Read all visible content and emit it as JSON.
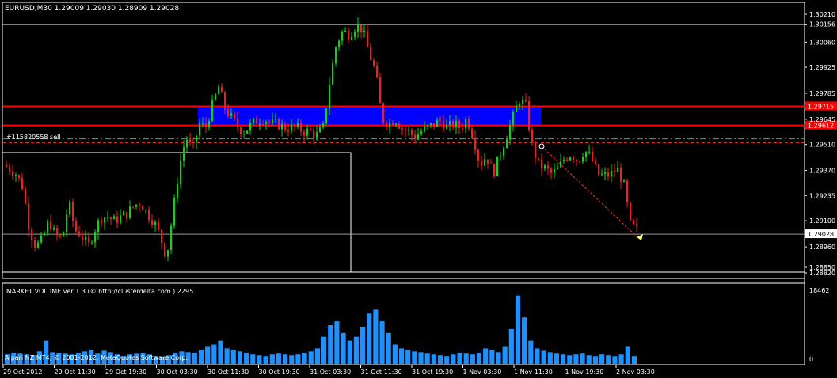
{
  "header": {
    "symbol_line": "EURUSD,M30  1.29009 1.29030 1.28909 1.29028"
  },
  "trade_label": "#115820558 sell",
  "indicator": {
    "title": "MARKET VOLUME ver 1.3 (© http://clusterdelta.com ) 2295",
    "scale_top": "18462",
    "scale_bottom": "0"
  },
  "copyright": "Alpari NZ MT4, © 2001-2012, MetaQuotes Software Corp.",
  "colors": {
    "background": "#000000",
    "bull": "#00e000",
    "bear": "#ff1a1a",
    "zone": "#0000ff",
    "volume": "#1e90ff",
    "level_line": "#ff0000"
  },
  "chart_data": {
    "type": "candlestick",
    "price_axis": {
      "ticks": [
        "1.30210",
        "1.30156",
        "1.30060",
        "1.29925",
        "1.29785",
        "1.29645",
        "1.29510",
        "1.29370",
        "1.29235",
        "1.29100",
        "1.28960",
        "1.28850",
        "1.28820"
      ],
      "ylim": [
        1.2882,
        1.3021
      ],
      "current_price": "1.29028"
    },
    "time_axis": {
      "ticks": [
        "29 Oct 2012",
        "29 Oct 11:30",
        "29 Oct 19:30",
        "30 Oct 03:30",
        "30 Oct 11:30",
        "30 Oct 19:30",
        "31 Oct 03:30",
        "31 Oct 11:30",
        "31 Oct 19:30",
        "1 Nov 03:30",
        "1 Nov 11:30",
        "1 Nov 19:30",
        "2 Nov 03:30"
      ]
    },
    "zone": {
      "price_top": 1.29715,
      "price_bottom": 1.29612,
      "top_tag": "1.29715",
      "bottom_tag": "1.29612"
    },
    "levels": [
      {
        "price": 1.29715,
        "style": "solid"
      },
      {
        "price": 1.29612,
        "style": "solid"
      },
      {
        "price": 1.2954,
        "style": "dashdot"
      },
      {
        "price": 1.2952,
        "style": "dashed"
      },
      {
        "price": 1.29028,
        "style": "grey"
      }
    ],
    "close_path": [
      1.294,
      1.2938,
      1.2935,
      1.2928,
      1.2905,
      1.2896,
      1.29,
      1.291,
      1.2902,
      1.29,
      1.292,
      1.2905,
      1.2902,
      1.2896,
      1.2905,
      1.2912,
      1.2912,
      1.291,
      1.2912,
      1.2914,
      1.2918,
      1.292,
      1.2914,
      1.291,
      1.2902,
      1.289,
      1.2915,
      1.294,
      1.2955,
      1.2948,
      1.2962,
      1.296,
      1.2972,
      1.2982,
      1.297,
      1.2965,
      1.296,
      1.2958,
      1.2962,
      1.2964,
      1.2965,
      1.2962,
      1.2962,
      1.296,
      1.296,
      1.296,
      1.2958,
      1.2958,
      1.2956,
      1.296,
      1.2985,
      1.3005,
      1.3012,
      1.301,
      1.3015,
      1.3013,
      1.3,
      1.299,
      1.2965,
      1.2962,
      1.2965,
      1.296,
      1.2958,
      1.2955,
      1.2958,
      1.296,
      1.2962,
      1.2964,
      1.296,
      1.2962,
      1.296,
      1.2965,
      1.2955,
      1.294,
      1.2945,
      1.2935,
      1.2945,
      1.2955,
      1.2965,
      1.2975,
      1.2972,
      1.295,
      1.294,
      1.2938,
      1.2935,
      1.2938,
      1.2944,
      1.2946,
      1.2942,
      1.2948,
      1.2944,
      1.2935,
      1.2934,
      1.2935,
      1.2938,
      1.293,
      1.2908,
      1.2905
    ],
    "volume": [
      0.12,
      0.14,
      0.13,
      0.12,
      0.11,
      0.16,
      0.3,
      0.15,
      0.14,
      0.13,
      0.12,
      0.14,
      0.16,
      0.18,
      0.13,
      0.17,
      0.15,
      0.12,
      0.1,
      0.12,
      0.13,
      0.14,
      0.12,
      0.1,
      0.09,
      0.11,
      0.14,
      0.16,
      0.15,
      0.14,
      0.18,
      0.22,
      0.25,
      0.3,
      0.2,
      0.18,
      0.16,
      0.14,
      0.12,
      0.11,
      0.1,
      0.12,
      0.13,
      0.12,
      0.11,
      0.12,
      0.14,
      0.16,
      0.2,
      0.35,
      0.5,
      0.55,
      0.4,
      0.3,
      0.35,
      0.48,
      0.65,
      0.7,
      0.55,
      0.4,
      0.25,
      0.2,
      0.18,
      0.16,
      0.15,
      0.13,
      0.12,
      0.11,
      0.1,
      0.12,
      0.14,
      0.13,
      0.12,
      0.14,
      0.2,
      0.18,
      0.15,
      0.22,
      0.45,
      0.88,
      0.6,
      0.3,
      0.2,
      0.17,
      0.15,
      0.13,
      0.12,
      0.11,
      0.12,
      0.13,
      0.11,
      0.1,
      0.12,
      0.11,
      0.1,
      0.12,
      0.22,
      0.1
    ]
  }
}
